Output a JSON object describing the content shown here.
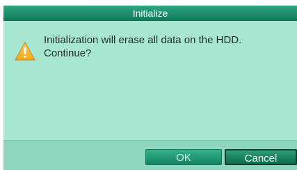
{
  "dialog": {
    "title": "Initialize",
    "message_line1": "Initialization will erase all data on the HDD.",
    "message_line2": "Continue?",
    "icon": "warning-icon"
  },
  "buttons": {
    "ok_label": "OK",
    "cancel_label": "Cancel"
  },
  "colors": {
    "title_bar": "#1d8d6c",
    "dialog_body": "#a7e6d0",
    "footer": "#8fd6be",
    "warning_icon": "#f0a818",
    "text": "#1d2b2a"
  }
}
